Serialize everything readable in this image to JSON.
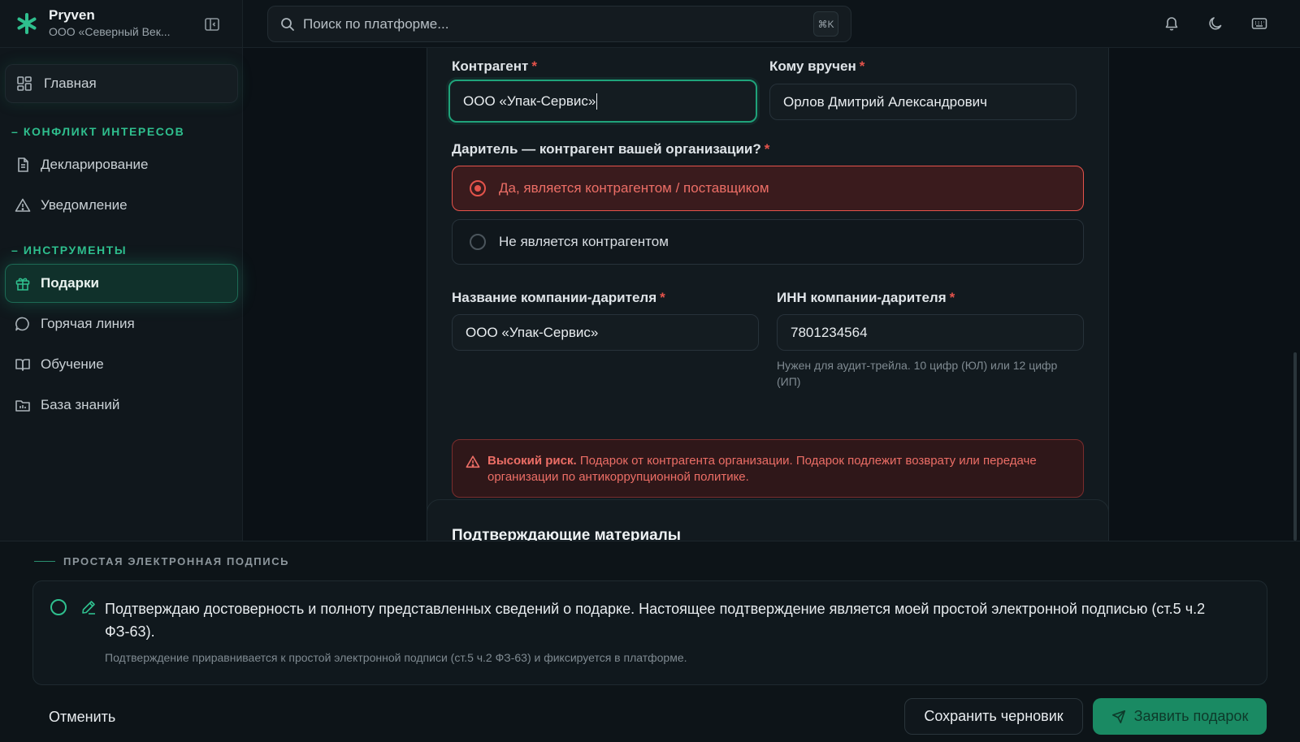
{
  "brand": {
    "name": "Pryven",
    "org": "ООО «Северный Век..."
  },
  "search": {
    "placeholder": "Поиск по платформе...",
    "shortcut": "⌘K"
  },
  "sidebar": {
    "home": "Главная",
    "sections": [
      {
        "title": "КОНФЛИКТ ИНТЕРЕСОВ",
        "items": [
          "Декларирование",
          "Уведомление"
        ]
      },
      {
        "title": "ИНСТРУМЕНТЫ",
        "items": [
          "Подарки",
          "Горячая линия",
          "Обучение",
          "База знаний"
        ]
      }
    ],
    "active": "Подарки"
  },
  "form": {
    "counterparty_label": "Контрагент",
    "counterparty_value": "ООО «Упак-Сервис»",
    "recipient_label": "Кому вручен",
    "recipient_value": "Орлов Дмитрий Александрович",
    "question": "Даритель — контрагент вашей организации?",
    "option_yes": "Да, является контрагентом / поставщиком",
    "option_no": "Не является контрагентом",
    "selected_option": "yes",
    "company_label": "Название компании-дарителя",
    "company_value": "ООО «Упак-Сервис»",
    "inn_label": "ИНН компании-дарителя",
    "inn_value": "7801234564",
    "inn_hint": "Нужен для аудит-трейла. 10 цифр (ЮЛ) или 12 цифр (ИП)",
    "alert_title": "Высокий риск.",
    "alert_text": "Подарок от контрагента организации. Подарок подлежит возврату или передаче организации по антикоррупционной политике.",
    "required_mark": "*"
  },
  "materials": {
    "title": "Подтверждающие материалы"
  },
  "esign": {
    "label": "ПРОСТАЯ ЭЛЕКТРОННАЯ ПОДПИСЬ",
    "text": "Подтверждаю достоверность и полноту представленных сведений о подарке. Настоящее подтверждение является моей простой электронной подписью (ст.5 ч.2 ФЗ-63).",
    "sub": "Подтверждение приравнивается к простой электронной подписи (ст.5 ч.2 ФЗ-63) и фиксируется в платформе.",
    "checked": false
  },
  "actions": {
    "cancel": "Отменить",
    "save_draft": "Сохранить черновик",
    "submit": "Заявить подарок"
  },
  "colors": {
    "accent": "#1fa37a",
    "danger": "#e5534b",
    "background": "#0b1116"
  }
}
